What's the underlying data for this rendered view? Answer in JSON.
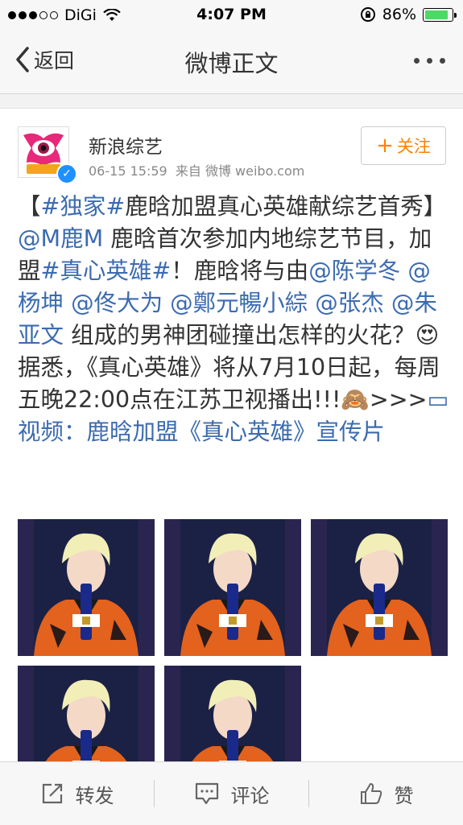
{
  "status": {
    "carrier": "DiGi",
    "time": "4:07 PM",
    "battery": "86%",
    "battery_level": 0.86,
    "battery_color": "#4cd964"
  },
  "nav": {
    "back_label": "返回",
    "title": "微博正文"
  },
  "post": {
    "username": "新浪综艺",
    "timestamp": "06-15 15:59",
    "source": "来自 微博 weibo.com",
    "follow_label": "关注",
    "segments": [
      {
        "t": "【",
        "link": false
      },
      {
        "t": "#独家#",
        "link": true
      },
      {
        "t": "鹿晗加盟真心英雄献综艺首秀】 ",
        "link": false
      },
      {
        "t": "@M鹿M",
        "link": true
      },
      {
        "t": " 鹿晗首次参加内地综艺节目，加盟",
        "link": false
      },
      {
        "t": "#真心英雄#",
        "link": true
      },
      {
        "t": "！鹿晗将与由",
        "link": false
      },
      {
        "t": "@陈学冬",
        "link": true
      },
      {
        "t": " ",
        "link": false
      },
      {
        "t": "@杨坤",
        "link": true
      },
      {
        "t": " ",
        "link": false
      },
      {
        "t": "@佟大为",
        "link": true
      },
      {
        "t": " ",
        "link": false
      },
      {
        "t": "@鄭元暢小綜",
        "link": true
      },
      {
        "t": " ",
        "link": false
      },
      {
        "t": "@张杰",
        "link": true
      },
      {
        "t": " ",
        "link": false
      },
      {
        "t": "@朱亚文",
        "link": true
      },
      {
        "t": " 组成的男神团碰撞出怎样的火花？",
        "link": false
      },
      {
        "t": "😍",
        "link": false
      },
      {
        "t": "据悉，《真心英雄》将从7月10日起，每周五晚22:00点在江苏卫视播出!!!",
        "link": false
      },
      {
        "t": "🙈",
        "link": false
      },
      {
        "t": ">>>",
        "link": false
      },
      {
        "t": "▭视频：鹿晗加盟《真心英雄》宣传片",
        "link": true
      }
    ]
  },
  "toolbar": {
    "repost": "转发",
    "comment": "评论",
    "like": "赞"
  },
  "colors": {
    "link": "#3c6bb0",
    "follow": "#ff8200",
    "verified": "#1e90ff"
  }
}
